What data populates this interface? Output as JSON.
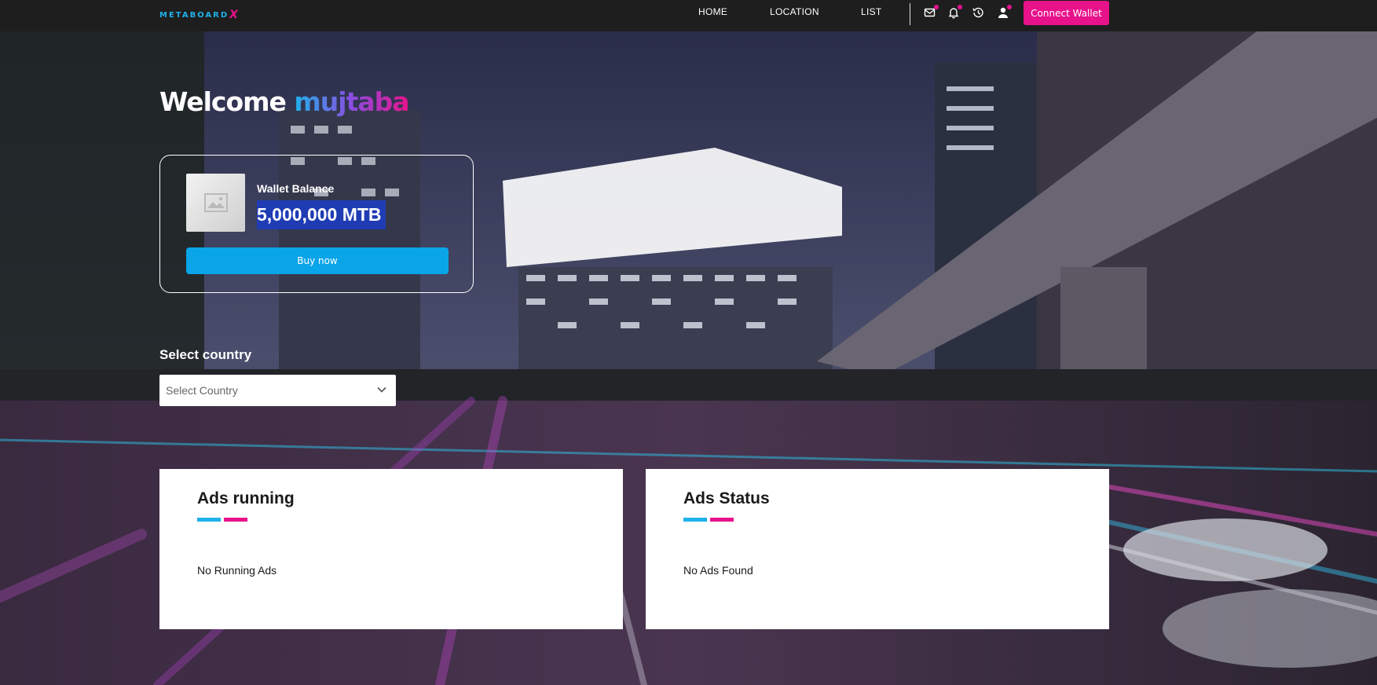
{
  "brand": {
    "logo_text": "METABOARD",
    "logo_x": "X"
  },
  "nav": {
    "links": [
      "HOME",
      "LOCATION",
      "LIST"
    ],
    "icons": [
      "mail-icon",
      "bell-icon",
      "history-icon",
      "user-icon"
    ],
    "connect_label": "Connect Wallet"
  },
  "welcome": {
    "greeting": "Welcome",
    "username": "mujtaba"
  },
  "wallet": {
    "label": "Wallet Balance",
    "balance": "5,000,000 MTB",
    "buy_label": "Buy now"
  },
  "country": {
    "label": "Select country",
    "placeholder": "Select Country"
  },
  "panels": {
    "running": {
      "title": "Ads running",
      "empty": "No Running Ads"
    },
    "status": {
      "title": "Ads Status",
      "empty": "No Ads Found"
    }
  },
  "colors": {
    "accent_pink": "#e8128a",
    "accent_blue": "#1fb1ea",
    "buy_blue": "#0aa4e8",
    "balance_highlight": "#1f3cb4"
  }
}
